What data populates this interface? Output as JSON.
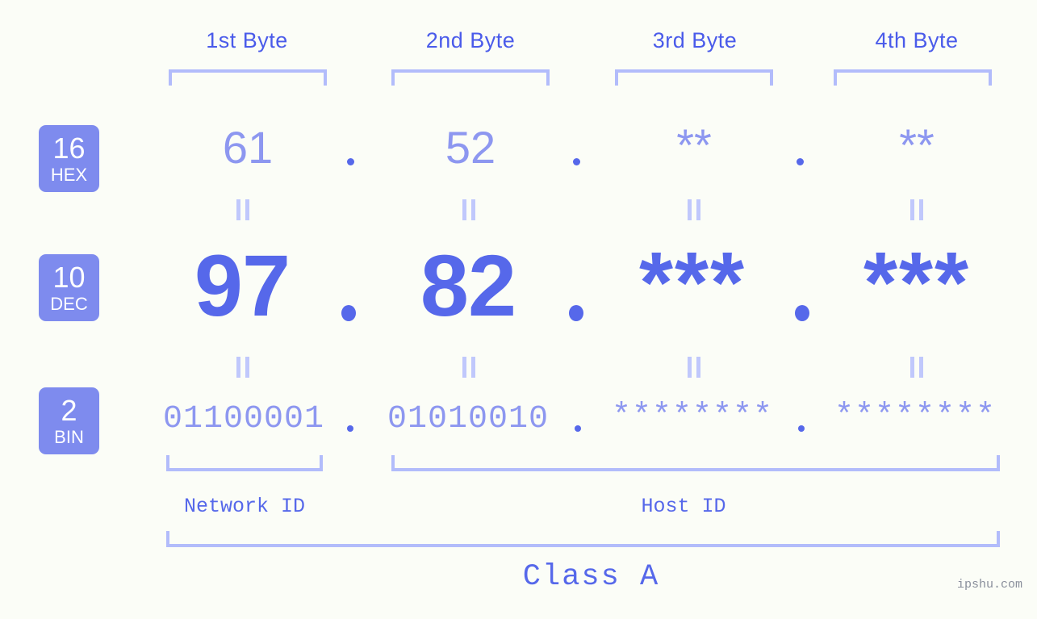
{
  "page": {
    "background_color": "#fbfdf7",
    "accent_color": "#5668ea",
    "accent_light_color": "#8d97f0",
    "bracket_color": "#b2bcfb",
    "badge_color": "#7e8bee",
    "watermark": "ipshu.com"
  },
  "byte_headers": [
    {
      "label": "1st Byte"
    },
    {
      "label": "2nd Byte"
    },
    {
      "label": "3rd Byte"
    },
    {
      "label": "4th Byte"
    }
  ],
  "rows": [
    {
      "base_number": "16",
      "base_name": "HEX",
      "values": [
        "61",
        "52",
        "**",
        "**"
      ],
      "separator": "."
    },
    {
      "base_number": "10",
      "base_name": "DEC",
      "values": [
        "97",
        "82",
        "***",
        "***"
      ],
      "separator": "."
    },
    {
      "base_number": "2",
      "base_name": "BIN",
      "values": [
        "01100001",
        "01010010",
        "********",
        "********"
      ],
      "separator": "."
    }
  ],
  "equals_marks": {
    "glyph": "||",
    "count_per_gap": 4
  },
  "segments": {
    "network_id": "Network ID",
    "host_id": "Host ID",
    "class": "Class A"
  }
}
